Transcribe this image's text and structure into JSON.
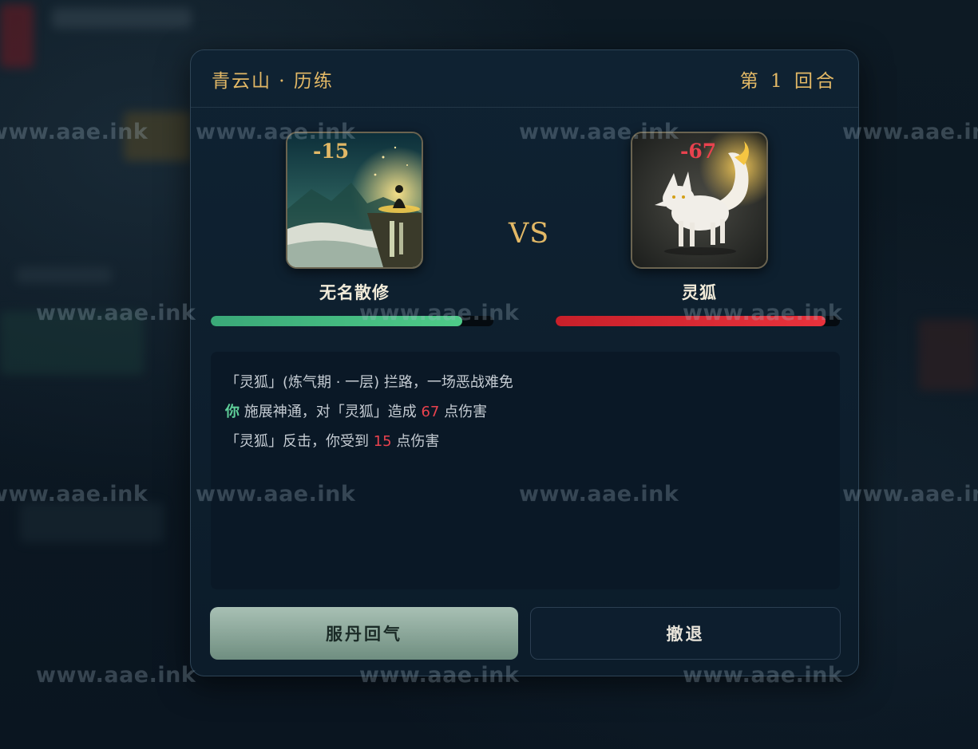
{
  "header": {
    "location": "青云山 · 历练",
    "round": "第 1 回合"
  },
  "player": {
    "name": "无名散修",
    "damage_taken": "-15",
    "hp_fraction": 0.89,
    "hp_color": "#4ecb88"
  },
  "versus": "VS",
  "enemy": {
    "name": "灵狐",
    "damage_taken": "-67",
    "hp_fraction": 0.95,
    "hp_color": "#e8323c"
  },
  "log": {
    "line1": "「灵狐」(炼气期 · 一层) 拦路，一场恶战难免",
    "line2": {
      "actor": "你",
      "text_a": " 施展神通，对「灵狐」造成 ",
      "damage": "67",
      "text_b": " 点伤害"
    },
    "line3": {
      "text_a": "「灵狐」反击，你受到 ",
      "damage": "15",
      "text_b": " 点伤害"
    }
  },
  "actions": {
    "potion_label": "服丹回气",
    "retreat_label": "撤退"
  },
  "watermark": "www.aae.ink",
  "colors": {
    "gold_accent": "#e2b866",
    "damage_red": "#e8424e",
    "player_green": "#5fcf99"
  }
}
